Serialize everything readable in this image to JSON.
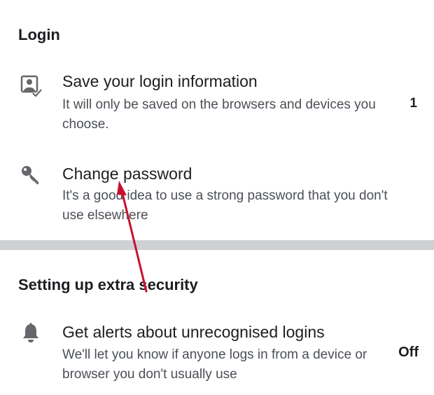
{
  "login_section": {
    "title": "Login",
    "items": [
      {
        "icon": "saved-login-icon",
        "title": "Save your login information",
        "description": "It will only be saved on the browsers and devices you choose.",
        "value": "1"
      },
      {
        "icon": "key-icon",
        "title": "Change password",
        "description": "It's a good idea to use a strong password that you don't use elsewhere"
      }
    ]
  },
  "security_section": {
    "title": "Setting up extra security",
    "items": [
      {
        "icon": "bell-icon",
        "title": "Get alerts about unrecognised logins",
        "description": "We'll let you know if anyone logs in from a device or browser you don't usually use",
        "value": "Off"
      }
    ]
  },
  "annotation": {
    "arrow_color": "#c8102e"
  },
  "colors": {
    "icon": "#65676b",
    "divider": "#cfd0d4",
    "text_primary": "#1c1e21",
    "text_secondary": "#4b4f56"
  }
}
